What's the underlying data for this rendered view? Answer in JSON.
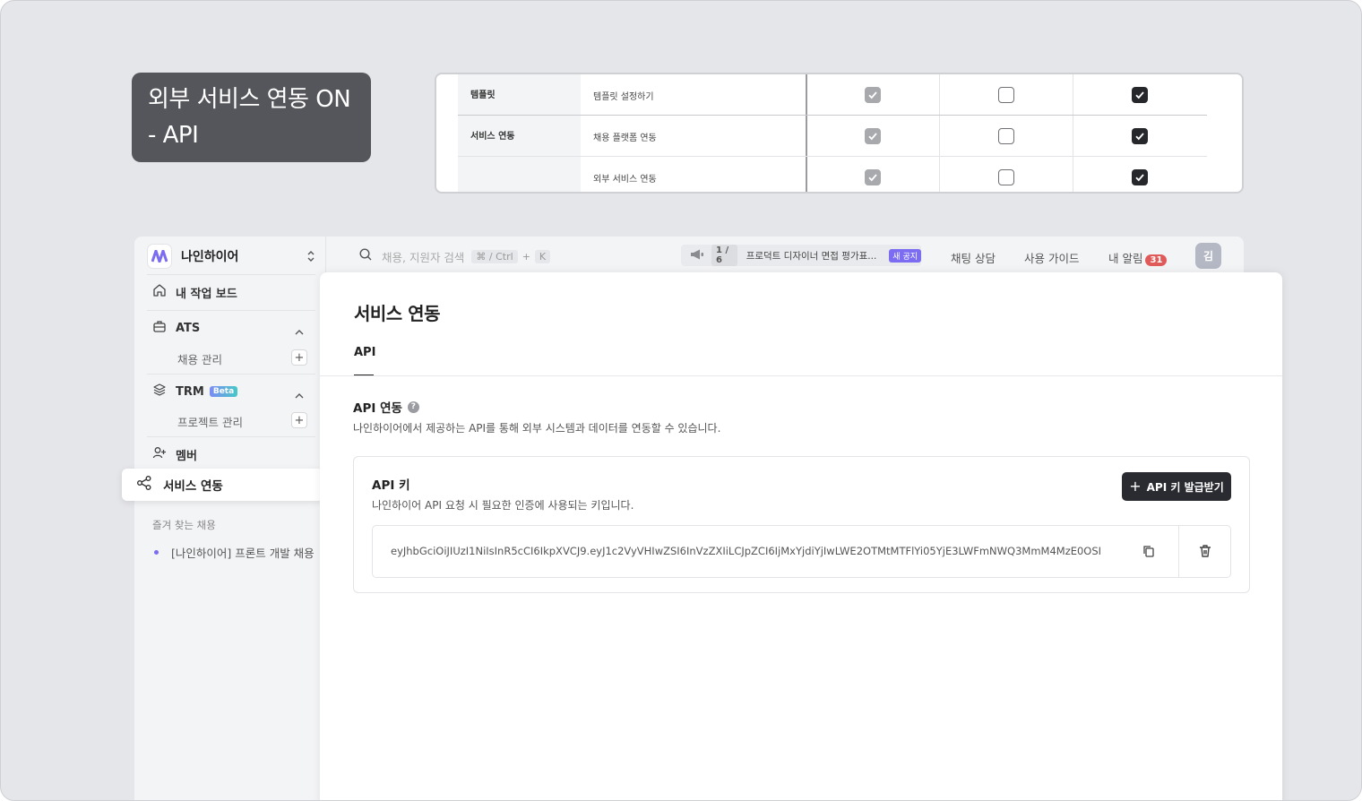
{
  "callout": {
    "line1": "외부 서비스 연동 ON",
    "line2": "- API"
  },
  "permission_table": {
    "rows": [
      {
        "category": "템플릿",
        "item": "템플릿 설정하기"
      },
      {
        "category": "서비스 연동",
        "item": "채용 플랫폼 연동"
      },
      {
        "category": "",
        "item": "외부 서비스 연동"
      }
    ]
  },
  "sidebar": {
    "workspace": "나인하이어",
    "dashboard": "내 작업 보드",
    "ats": {
      "label": "ATS",
      "sub": "채용 관리"
    },
    "trm": {
      "label": "TRM",
      "badge": "Beta",
      "sub": "프로젝트 관리"
    },
    "member": "멤버",
    "service": "서비스 연동",
    "favorites_title": "즐겨 찾는 채용",
    "favorite_item": "[나인하이어] 프론트 개발 채용"
  },
  "topbar": {
    "search_placeholder": "채용, 지원자 검색",
    "shortcut": "⌘ / Ctrl",
    "shortcut_plus": "+",
    "shortcut_key": "K",
    "notice_count": "1 / 6",
    "notice_text": "프로덕트 디자이너 면접 평가표...",
    "notice_badge": "새 공지",
    "chat": "채팅 상담",
    "guide": "사용 가이드",
    "alarm": "내 알림",
    "alarm_count": "31",
    "avatar": "김"
  },
  "main": {
    "title": "서비스 연동",
    "tab": "API",
    "section_title": "API 연동",
    "help": "?",
    "section_desc": "나인하이어에서 제공하는 API를 통해 외부 시스템과 데이터를 연동할 수 있습니다.",
    "key_title": "API 키",
    "key_desc": "나인하이어 API 요청 시 필요한 인증에 사용되는 키입니다.",
    "issue_button": "API 키 발급받기",
    "key_value": "eyJhbGciOiJIUzI1NiIsInR5cCI6IkpXVCJ9.eyJ1c2VyVHIwZSI6InVzZXIiLCJpZCI6IjMxYjdiYjIwLWE2OTMtMTFlYi05YjE3LWFmNWQ3MmM4MzE0OSI"
  }
}
